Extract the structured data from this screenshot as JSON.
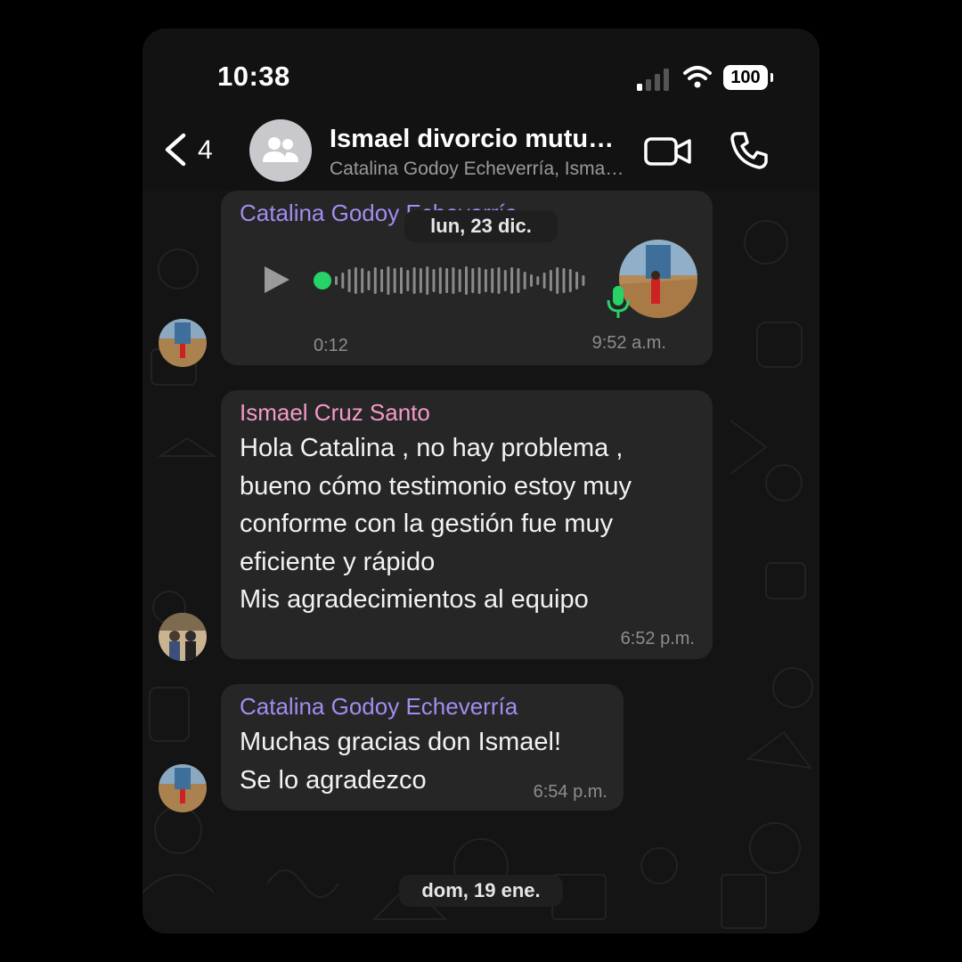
{
  "status_bar": {
    "time": "10:38",
    "battery": "100",
    "signal_icon": "cellular-signal-icon",
    "wifi_icon": "wifi-icon"
  },
  "header": {
    "back_count": "4",
    "title": "Ismael divorcio mutuo acuerdo",
    "subtitle": "Catalina Godoy Echeverría, Ismael Cruz Santo",
    "icons": [
      "chevron-left-icon",
      "group-icon",
      "video-camera-icon",
      "phone-icon"
    ]
  },
  "colors": {
    "accent_green": "#25d366",
    "sender_catalina": "#a48cf0",
    "sender_ismael": "#f29ac8",
    "bubble": "#262626"
  },
  "dates": {
    "first": "lun, 23 dic.",
    "second": "dom, 19 ene."
  },
  "messages": [
    {
      "sender": "Catalina Godoy Echeverría",
      "type": "voice",
      "duration": "0:12",
      "time": "9:52 a.m.",
      "voice_progress": 0
    },
    {
      "sender": "Ismael Cruz Santo",
      "type": "text",
      "text": "Hola Catalina , no hay problema ,\nbueno cómo testimonio estoy muy\nconforme con la gestión fue muy\neficiente y rápido\nMis agradecimientos al equipo",
      "time": "6:52 p.m."
    },
    {
      "sender": "Catalina Godoy Echeverría",
      "type": "text",
      "text": "Muchas gracias don Ismael!\nSe lo agradezco",
      "time": "6:54 p.m."
    }
  ]
}
